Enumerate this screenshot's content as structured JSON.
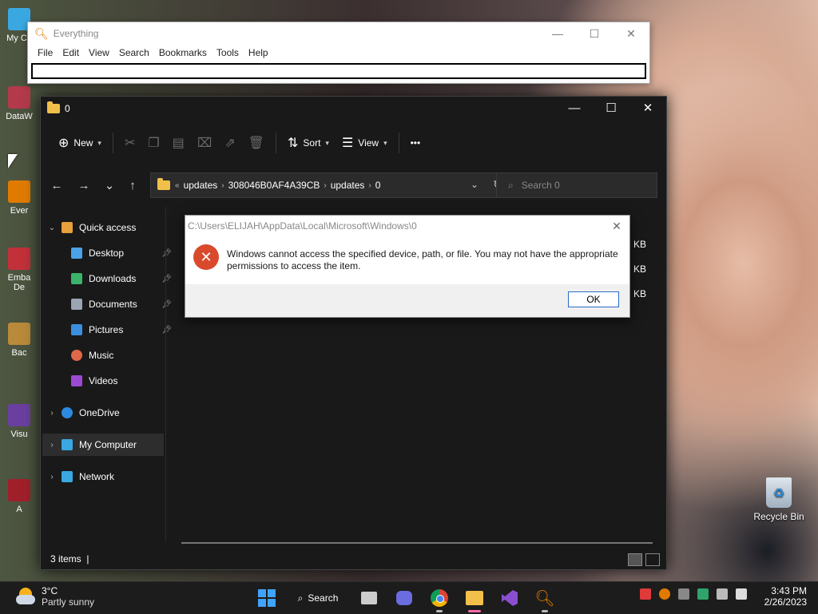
{
  "desktop": {
    "left_icons": [
      "My Co",
      "DataW",
      "Ever",
      "Emba De",
      "Bac",
      "Visu",
      "A"
    ],
    "recycle_bin": "Recycle Bin"
  },
  "everything": {
    "title": "Everything",
    "menu": [
      "File",
      "Edit",
      "View",
      "Search",
      "Bookmarks",
      "Tools",
      "Help"
    ]
  },
  "explorer": {
    "title": "0",
    "toolbar": {
      "new": "New",
      "sort": "Sort",
      "view": "View",
      "more": "•••"
    },
    "breadcrumb": {
      "overflow": "«",
      "items": [
        "updates",
        "308046B0AF4A39CB",
        "updates",
        "0"
      ]
    },
    "search_placeholder": "Search 0",
    "nav": {
      "quick_access": "Quick access",
      "desktop": "Desktop",
      "downloads": "Downloads",
      "documents": "Documents",
      "pictures": "Pictures",
      "music": "Music",
      "videos": "Videos",
      "onedrive": "OneDrive",
      "my_computer": "My Computer",
      "network": "Network"
    },
    "file_sizes": [
      "92 KB",
      "1 KB",
      "1 KB"
    ],
    "status": "3 items"
  },
  "dialog": {
    "title": "C:\\Users\\ELIJAH\\AppData\\Local\\Microsoft\\Windows\\0",
    "message": "Windows cannot access the specified device, path, or file. You may not have the appropriate permissions to access the item.",
    "ok": "OK"
  },
  "taskbar": {
    "temp": "3°C",
    "weather": "Partly sunny",
    "search": "Search",
    "time": "3:43 PM",
    "date": "2/26/2023"
  },
  "colors": {
    "accent": "#2a6cc8",
    "error": "#d94a2d",
    "folder": "#f2c04a",
    "dark_bg": "#191919"
  }
}
